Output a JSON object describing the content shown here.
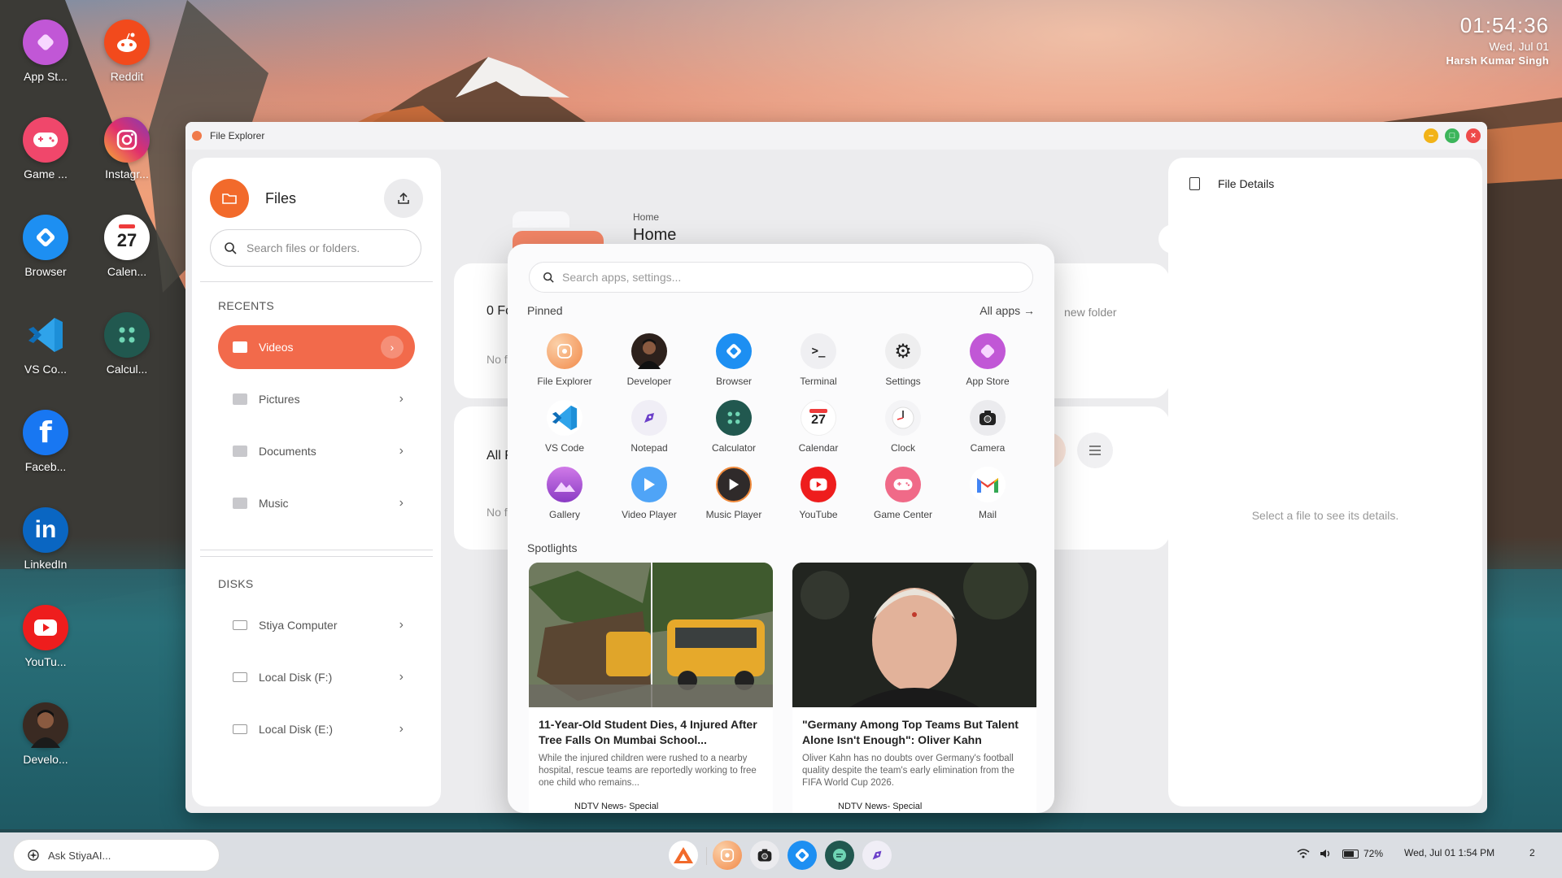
{
  "clock": {
    "time": "01:54:36",
    "date": "Wed, Jul 01",
    "user": "Harsh Kumar Singh"
  },
  "desktop_icons": [
    {
      "label": "App St...",
      "icon": "app-store-icon",
      "color": "#c157d6"
    },
    {
      "label": "Reddit",
      "icon": "reddit-icon",
      "color": "#f24a1c"
    },
    {
      "label": "Game ...",
      "icon": "game-center-icon",
      "color": "#f0476b"
    },
    {
      "label": "Instagr...",
      "icon": "instagram-icon",
      "color": "#d8336f"
    },
    {
      "label": "Browser",
      "icon": "browser-icon",
      "color": "#1d8ff2"
    },
    {
      "label": "Calen...",
      "icon": "calendar-icon",
      "color": "#ffffff",
      "day": "27"
    },
    {
      "label": "VS Co...",
      "icon": "vscode-icon",
      "color": "#1d8fd8"
    },
    {
      "label": "Calcul...",
      "icon": "calculator-icon",
      "color": "#21584f"
    },
    {
      "label": "Faceb...",
      "icon": "facebook-icon",
      "color": "#1877f2",
      "glyph": "f"
    },
    {
      "label": "LinkedIn",
      "icon": "linkedin-icon",
      "color": "#0a66c2",
      "glyph": "in"
    },
    {
      "label": "YouTu...",
      "icon": "youtube-icon",
      "color": "#ee1d1d"
    },
    {
      "label": "Develo...",
      "icon": "developer-avatar-icon",
      "color": "#3a2a22"
    }
  ],
  "window": {
    "title": "File Explorer",
    "sidebar": {
      "title": "Files",
      "search_placeholder": "Search files or folders.",
      "recents_label": "RECENTS",
      "recents": [
        "Videos",
        "Pictures",
        "Documents",
        "Music"
      ],
      "disks_label": "DISKS",
      "disks": [
        "Stiya Computer",
        "Local Disk (F:)",
        "Local Disk (E:)"
      ]
    },
    "main": {
      "breadcrumb": "Home",
      "title": "Home",
      "folders_heading": "0 Fo",
      "folders_empty": "No fo",
      "new_folder": "new folder",
      "files_heading": "All F",
      "files_empty": "No fi"
    },
    "details": {
      "title": "File Details",
      "hint": "Select a file to see its details."
    }
  },
  "start_menu": {
    "search_placeholder": "Search apps, settings...",
    "pinned_label": "Pinned",
    "all_apps": "All apps →",
    "apps": [
      {
        "label": "File Explorer",
        "icon": "file-explorer-icon",
        "color": "#f6a26a"
      },
      {
        "label": "Developer",
        "icon": "developer-avatar-icon",
        "color": "#2d211c"
      },
      {
        "label": "Browser",
        "icon": "browser-icon",
        "color": "#1d8ff2"
      },
      {
        "label": "Terminal",
        "icon": "terminal-icon",
        "color": "#efeff2",
        "glyph": ">_"
      },
      {
        "label": "Settings",
        "icon": "settings-gear-icon",
        "color": "#eeeeef",
        "glyph": "⚙"
      },
      {
        "label": "App Store",
        "icon": "app-store-icon",
        "color": "#c157d6"
      },
      {
        "label": "VS Code",
        "icon": "vscode-icon",
        "color": "#ffffff"
      },
      {
        "label": "Notepad",
        "icon": "notepad-icon",
        "color": "#f0eef6"
      },
      {
        "label": "Calculator",
        "icon": "calculator-icon",
        "color": "#21584f"
      },
      {
        "label": "Calendar",
        "icon": "calendar-icon",
        "color": "#ffffff",
        "day": "27"
      },
      {
        "label": "Clock",
        "icon": "clock-icon",
        "color": "#f4f4f6"
      },
      {
        "label": "Camera",
        "icon": "camera-icon",
        "color": "#ebebee"
      },
      {
        "label": "Gallery",
        "icon": "gallery-icon",
        "color": "#b05bd6"
      },
      {
        "label": "Video Player",
        "icon": "video-player-icon",
        "color": "#4fa4f7"
      },
      {
        "label": "Music Player",
        "icon": "music-player-icon",
        "color": "#2f2a2a"
      },
      {
        "label": "YouTube",
        "icon": "youtube-icon",
        "color": "#ee1d1d"
      },
      {
        "label": "Game Center",
        "icon": "game-center-icon",
        "color": "#f06a88"
      },
      {
        "label": "Mail",
        "icon": "gmail-icon",
        "color": "#ffffff",
        "glyph": "M"
      }
    ],
    "spotlights_label": "Spotlights",
    "spotlights": [
      {
        "headline": "11-Year-Old Student Dies, 4 Injured After Tree Falls On Mumbai School...",
        "desc": "While the injured children were rushed to a nearby hospital, rescue teams are reportedly working to free one child who remains...",
        "source": "NDTV News- Special"
      },
      {
        "headline": "\"Germany Among Top Teams But Talent Alone Isn't Enough\": Oliver Kahn",
        "desc": "Oliver Kahn has no doubts over Germany's football quality despite the team's early elimination from the FIFA World Cup 2026.",
        "source": "NDTV News- Special"
      }
    ]
  },
  "taskbar": {
    "ask_label": "Ask StiyaAI...",
    "apps": [
      {
        "icon": "launcher-icon",
        "color": "#ffffff"
      },
      {
        "icon": "file-explorer-icon",
        "color": "#f6a26a"
      },
      {
        "icon": "camera-icon",
        "color": "#ebebee"
      },
      {
        "icon": "browser-icon",
        "color": "#1d8ff2"
      },
      {
        "icon": "chat-icon",
        "color": "#21584f"
      },
      {
        "icon": "notepad-icon",
        "color": "#f0eef6"
      }
    ],
    "battery": "72%",
    "datetime": "Wed, Jul 01  1:54 PM",
    "notifications": "2"
  }
}
